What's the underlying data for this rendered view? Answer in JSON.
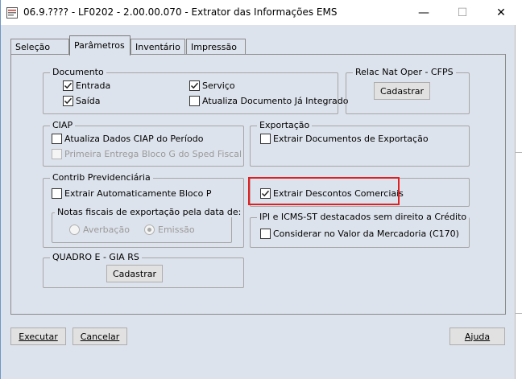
{
  "window": {
    "title": "06.9.???? - LF0202 - 2.00.00.070 - Extrator das Informações EMS",
    "minimize_glyph": "—",
    "maximize_glyph": "☐",
    "close_glyph": "✕"
  },
  "tabs": [
    {
      "label": "Seleção"
    },
    {
      "label": "Parâmetros"
    },
    {
      "label": "Inventário"
    },
    {
      "label": "Impressão"
    }
  ],
  "documento": {
    "title": "Documento",
    "entrada": "Entrada",
    "saida": "Saída",
    "servico": "Serviço",
    "atualiza": "Atualiza Documento Já Integrado"
  },
  "relac": {
    "title": "Relac Nat Oper - CFPS",
    "button": "Cadastrar"
  },
  "ciap": {
    "title": "CIAP",
    "atualiza": "Atualiza Dados CIAP do Período",
    "primeira": "Primeira Entrega Bloco G do Sped Fiscal"
  },
  "exportacao": {
    "title": "Exportação",
    "extrair": "Extrair Documentos de Exportação"
  },
  "contrib": {
    "title": "Contrib Previdenciária",
    "extrair": "Extrair Automaticamente Bloco P"
  },
  "notas": {
    "title": "Notas fiscais de exportação pela data de:",
    "averbacao": "Averbação",
    "emissao": "Emissão"
  },
  "descontos": {
    "extrair": "Extrair Descontos Comerciais"
  },
  "ipi": {
    "title": "IPI e ICMS-ST destacados sem direito a Crédito",
    "considerar": "Considerar no Valor da Mercadoria (C170)"
  },
  "quadro": {
    "title": "QUADRO E - GIA RS",
    "button": "Cadastrar"
  },
  "footer": {
    "executar": "Executar",
    "cancelar": "Cancelar",
    "ajuda": "Ajuda"
  },
  "colors": {
    "highlight": "#e02020",
    "window_bg": "#dde3ec"
  }
}
